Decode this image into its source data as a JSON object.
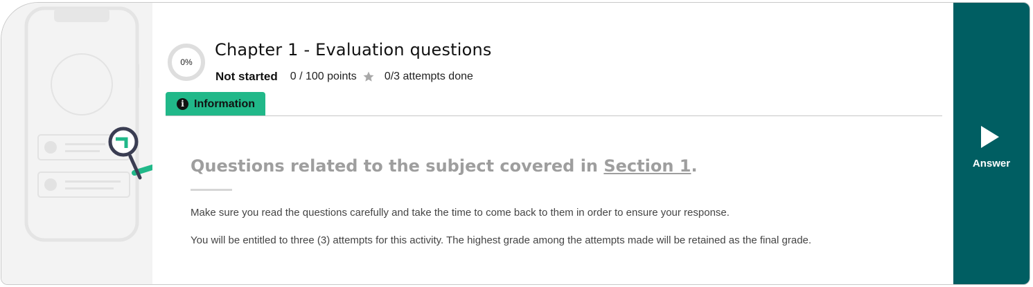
{
  "activity": {
    "progress_label": "0%",
    "progress_fraction": 0,
    "title": "Chapter 1 - Evaluation questions",
    "status": "Not started",
    "points": "0 / 100 points",
    "attempts": "0/3 attempts done"
  },
  "tabs": [
    {
      "label": "Information",
      "icon": "info-icon",
      "active": true
    }
  ],
  "content": {
    "heading_prefix": "Questions related to the subject covered in ",
    "heading_link": "Section 1",
    "heading_suffix": ".",
    "paragraphs": [
      "Make sure you read the questions carefully and take the time to come back to them in order to ensure your response.",
      "You will be entitled to three (3) attempts for this activity. The highest grade among the attempts made will be retained as the final grade."
    ]
  },
  "answer_button": {
    "label": "Answer",
    "icon": "play-icon"
  },
  "colors": {
    "accent_green": "#21b889",
    "panel_teal": "#005e62",
    "heading_gray": "#9e9e9e"
  }
}
